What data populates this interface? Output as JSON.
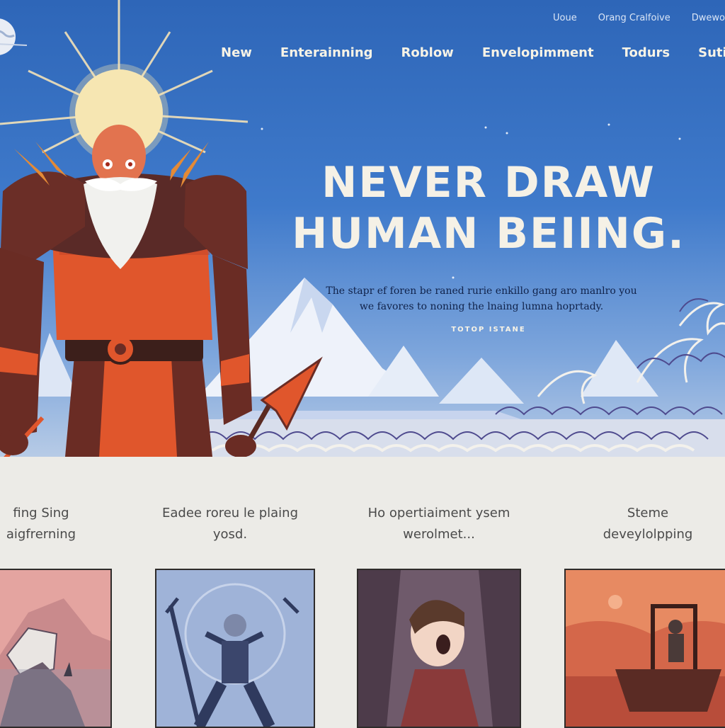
{
  "top_links": [
    "Uoue",
    "Orang Cralfoive",
    "Dwewo"
  ],
  "nav": [
    "New",
    "Enterainning",
    "Roblow",
    "Envelopimment",
    "Todurs",
    "Suting"
  ],
  "hero": {
    "headline_line1": "NEVER DRAW",
    "headline_line2": "HUMAN BEIING.",
    "subtext_line1": "The stapr ef foren be raned rurie enkillo gang aro manlro you",
    "subtext_line2": "we favores to noning the lnaing lumna hoprtady.",
    "tagline": "TOTOP ISTANE"
  },
  "cards": [
    {
      "title_line1": "fing Sing",
      "title_line2": "aigfrerning"
    },
    {
      "title_line1": "Eadee roreu le plaing",
      "title_line2": "yosd."
    },
    {
      "title_line1": "Ho opertiaiment ysem",
      "title_line2": "werolmet..."
    },
    {
      "title_line1": "Steme",
      "title_line2": "deveylolpping"
    }
  ],
  "colors": {
    "sky": "#3f7acb",
    "armor_orange": "#e0562c",
    "armor_dark": "#6a2c24",
    "cream_text": "#f5f1e6",
    "page_bg": "#ecebe7"
  },
  "icons": [
    "moon-icon",
    "sun-icon"
  ]
}
